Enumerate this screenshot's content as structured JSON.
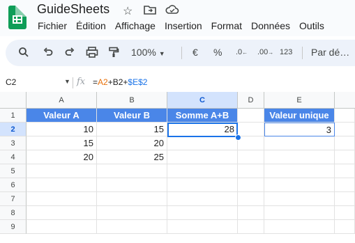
{
  "app": {
    "title": "GuideSheets",
    "title_icons": [
      "star-icon",
      "folder-move-icon",
      "cloud-status-icon"
    ]
  },
  "menu": [
    "Fichier",
    "Édition",
    "Affichage",
    "Insertion",
    "Format",
    "Données",
    "Outils"
  ],
  "toolbar": {
    "zoom": "100%",
    "currency": "€",
    "percent": "%",
    "decrease_decimals": ".0",
    "increase_decimals": ".00",
    "number_format": "123",
    "font_default": "Par dé…"
  },
  "formula_bar": {
    "name_box": "C2",
    "fx": "fx",
    "formula_parts": [
      "=",
      "A2",
      "+B2+",
      "$E$2"
    ]
  },
  "columns": [
    "A",
    "B",
    "C",
    "D",
    "E"
  ],
  "rows": [
    "1",
    "2",
    "3",
    "4",
    "5",
    "6",
    "7",
    "8",
    "9"
  ],
  "cells": {
    "A1": "Valeur A",
    "B1": "Valeur B",
    "C1": "Somme A+B",
    "E1": "Valeur unique",
    "A2": "10",
    "B2": "15",
    "C2": "28",
    "E2": "3",
    "A3": "15",
    "B3": "20",
    "A4": "20",
    "B4": "25"
  },
  "colors": {
    "header_fill": "#4a86e8",
    "selection": "#1a73e8",
    "brand_green": "#0f9d58"
  }
}
